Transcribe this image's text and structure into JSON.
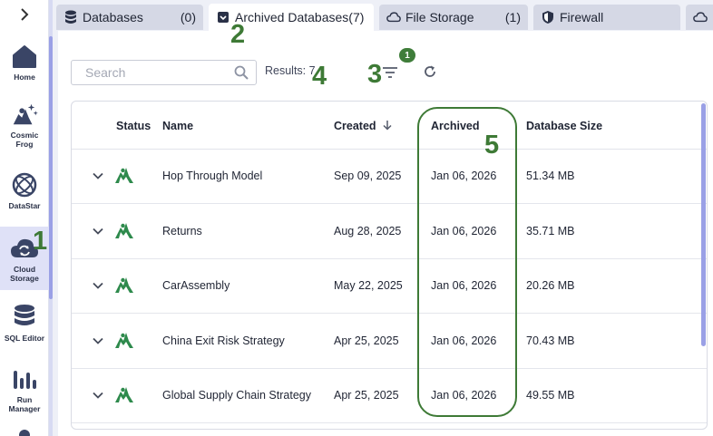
{
  "nav": {
    "items": [
      {
        "label": "Home",
        "icon": "home-icon"
      },
      {
        "label": "Cosmic Frog",
        "icon": "cosmic-frog-icon"
      },
      {
        "label": "DataStar",
        "icon": "datastar-icon"
      },
      {
        "label": "Cloud Storage",
        "icon": "cloud-storage-icon"
      },
      {
        "label": "SQL Editor",
        "icon": "sql-editor-icon"
      },
      {
        "label": "Run Manager",
        "icon": "run-manager-icon"
      }
    ]
  },
  "tabs": [
    {
      "label": "Databases",
      "count": "(0)",
      "icon": "database-icon"
    },
    {
      "label": "Archived Databases(7)",
      "count": "",
      "icon": "archive-icon"
    },
    {
      "label": "File Storage",
      "count": "(1)",
      "icon": "cloud-icon"
    },
    {
      "label": "Firewall",
      "count": "",
      "icon": "shield-icon"
    }
  ],
  "toolbar": {
    "search_placeholder": "Search",
    "results_text": "Results: 7",
    "filter_badge": "1"
  },
  "table": {
    "columns": {
      "status": "Status",
      "name": "Name",
      "created": "Created",
      "archived": "Archived",
      "size": "Database Size"
    },
    "rows": [
      {
        "name": "Hop Through Model",
        "created": "Sep 09, 2025",
        "archived": "Jan 06, 2026",
        "size": "51.34 MB"
      },
      {
        "name": "Returns",
        "created": "Aug 28, 2025",
        "archived": "Jan 06, 2026",
        "size": "35.71 MB"
      },
      {
        "name": "CarAssembly",
        "created": "May 22, 2025",
        "archived": "Jan 06, 2026",
        "size": "20.26 MB"
      },
      {
        "name": "China Exit Risk Strategy",
        "created": "Apr 25, 2025",
        "archived": "Jan 06, 2026",
        "size": "70.43 MB"
      },
      {
        "name": "Global Supply Chain Strategy",
        "created": "Apr 25, 2025",
        "archived": "Jan 06, 2026",
        "size": "49.55 MB"
      }
    ]
  },
  "annotations": [
    "1",
    "2",
    "3",
    "4",
    "5"
  ],
  "colors": {
    "accent": "#3e7a36",
    "rail_active": "#dfe1f7",
    "scroll": "#9aa0e6"
  }
}
